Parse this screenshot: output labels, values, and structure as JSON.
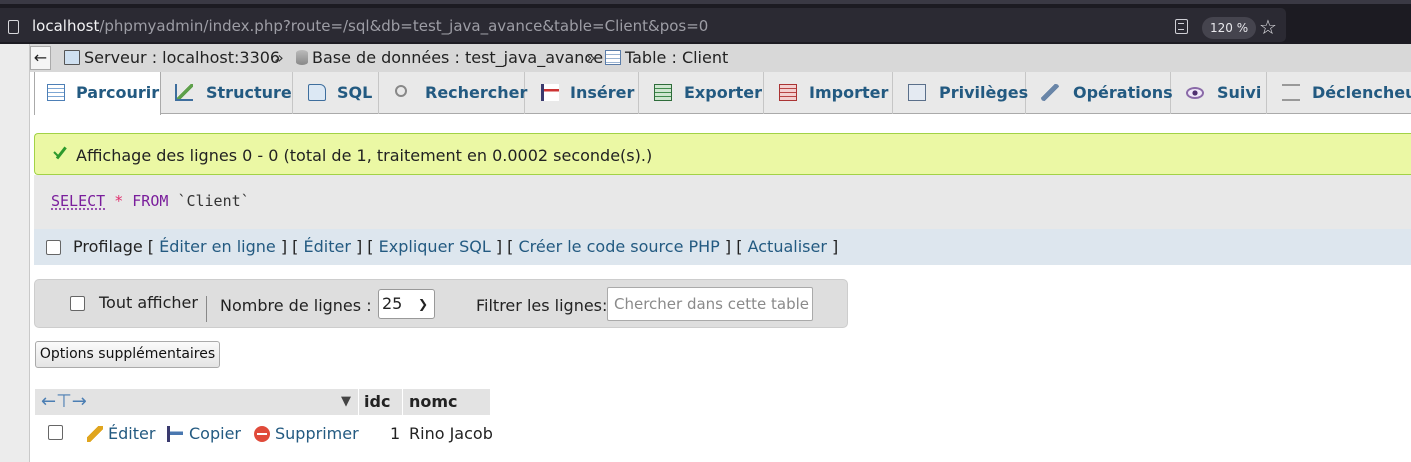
{
  "browser": {
    "url_host": "localhost",
    "url_path": "/phpmyadmin/index.php?route=/sql&db=test_java_avance&table=Client&pos=0",
    "zoom": "120 %"
  },
  "breadcrumb": {
    "toggle": "←",
    "server": "Serveur : localhost:3306",
    "sep1": "»",
    "database": "Base de données : test_java_avance",
    "sep2": "»",
    "table": "Table : Client"
  },
  "tabs": [
    {
      "label": "Parcourir",
      "icon": "browse-icon",
      "active": true
    },
    {
      "label": "Structure",
      "icon": "structure-icon"
    },
    {
      "label": "SQL",
      "icon": "sql-icon"
    },
    {
      "label": "Rechercher",
      "icon": "search-icon"
    },
    {
      "label": "Insérer",
      "icon": "insert-icon"
    },
    {
      "label": "Exporter",
      "icon": "export-icon"
    },
    {
      "label": "Importer",
      "icon": "import-icon"
    },
    {
      "label": "Privilèges",
      "icon": "privileges-icon"
    },
    {
      "label": "Opérations",
      "icon": "operations-icon"
    },
    {
      "label": "Suivi",
      "icon": "tracking-icon"
    },
    {
      "label": "Déclencheurs",
      "icon": "triggers-icon"
    }
  ],
  "message": {
    "text": "Affichage des lignes 0 - 0 (total de 1, traitement en 0.0002 seconde(s).)"
  },
  "sql": {
    "select": "SELECT",
    "star": "*",
    "from": "FROM",
    "table": "`Client`"
  },
  "profiling": {
    "label": "Profilage",
    "links": [
      "Éditer en ligne",
      "Éditer",
      "Expliquer SQL",
      "Créer le code source PHP",
      "Actualiser"
    ]
  },
  "navigation": {
    "show_all": "Tout afficher",
    "rows_label": "Nombre de lignes :",
    "rows_value": "25",
    "filter_label": "Filtrer les lignes:",
    "filter_placeholder": "Chercher dans cette table"
  },
  "options_button": "Options supplémentaires",
  "results": {
    "columns": [
      "idc",
      "nomc"
    ],
    "actions": {
      "edit": "Éditer",
      "copy": "Copier",
      "delete": "Supprimer"
    },
    "rows": [
      {
        "idc": "1",
        "nomc": "Rino Jacob"
      }
    ]
  },
  "colors": {
    "link": "#235a81",
    "success_bg": "#ebf8a4",
    "browser_bg": "#1c1b22"
  }
}
